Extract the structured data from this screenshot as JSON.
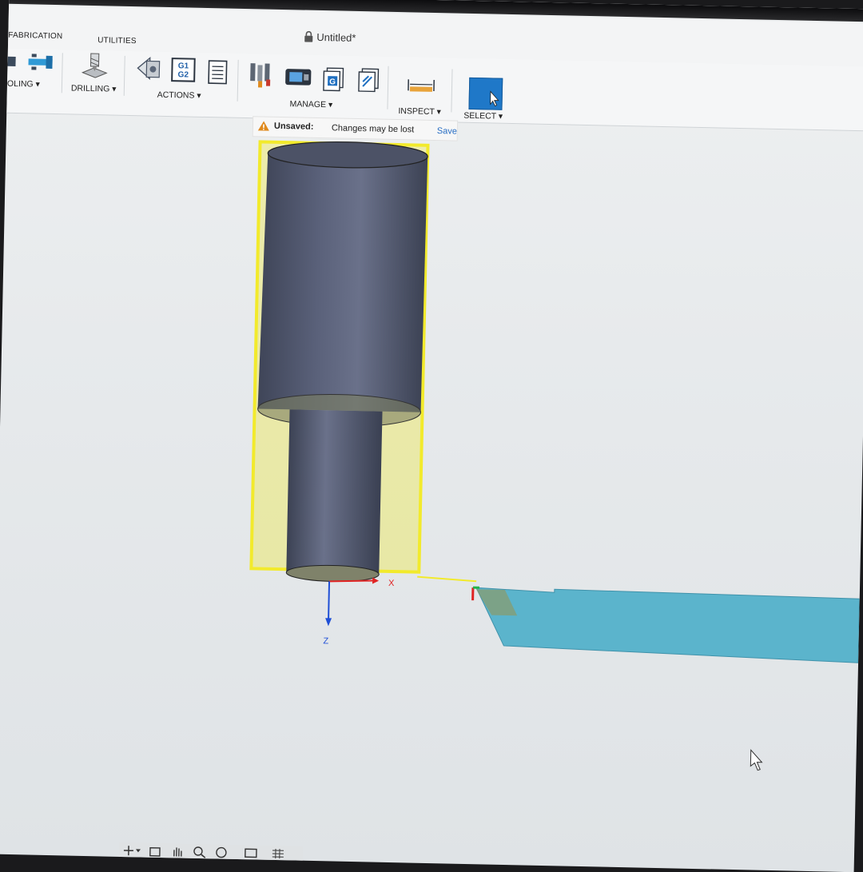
{
  "window": {
    "title": "Untitled*"
  },
  "tabs": {
    "fabrication": "FABRICATION",
    "utilities": "UTILITIES"
  },
  "groups": {
    "tooling": "OLING ▾",
    "drilling": "DRILLING ▾",
    "actions": "ACTIONS ▾",
    "manage": "MANAGE ▾",
    "inspect": "INSPECT ▾",
    "select": "SELECT ▾"
  },
  "icons": {
    "lock": "lock-icon",
    "warning": "warning-icon",
    "cursor": "mouse-pointer-icon"
  },
  "gcode_icon": {
    "line1": "G1",
    "line2": "G2",
    "g": "G"
  },
  "banner": {
    "label": "Unsaved:",
    "message": "Changes may be lost",
    "action": "Save"
  },
  "axes": {
    "x": "X",
    "z": "Z"
  },
  "colors": {
    "selection": "#f2ea2c",
    "stock": "#4a5066",
    "tool": "#5bb4cc",
    "accent": "#1f78c8",
    "x_axis": "#e02424",
    "z_axis": "#1f4fd6",
    "y_axis": "#22b34a"
  }
}
